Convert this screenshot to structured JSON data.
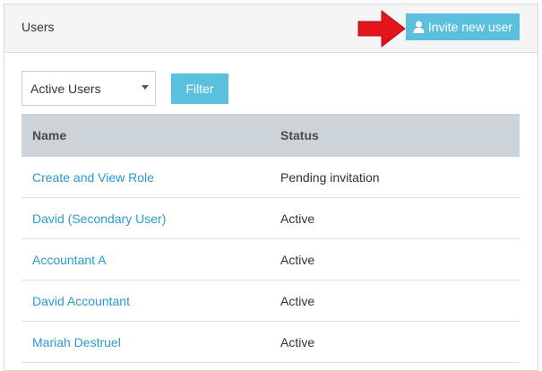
{
  "header": {
    "title": "Users",
    "invite_label": "Invite new user"
  },
  "filters": {
    "select_value": "Active Users",
    "filter_label": "Filter"
  },
  "table": {
    "columns": [
      "Name",
      "Status"
    ],
    "rows": [
      {
        "name": "Create and View Role",
        "status": "Pending invitation"
      },
      {
        "name": "David (Secondary User)",
        "status": "Active"
      },
      {
        "name": "Accountant A",
        "status": "Active"
      },
      {
        "name": "David Accountant",
        "status": "Active"
      },
      {
        "name": "Mariah Destruel",
        "status": "Active"
      }
    ]
  },
  "colors": {
    "accent": "#5bc0de",
    "link": "#2a9bcf",
    "table_header": "#ccd4da",
    "arrow": "#e3141c"
  },
  "icons": {
    "invite": "user-icon",
    "pointer": "red-arrow-icon"
  }
}
